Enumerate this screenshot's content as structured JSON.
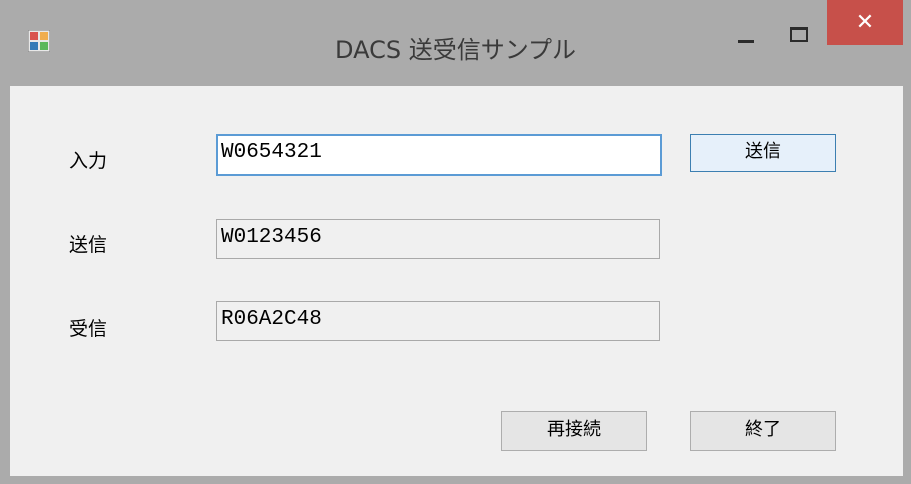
{
  "window": {
    "title": "DACS 送受信サンプル",
    "close_glyph": "✕"
  },
  "form": {
    "input": {
      "label": "入力",
      "value": "W0654321"
    },
    "send": {
      "label": "送信",
      "value": "W0123456"
    },
    "receive": {
      "label": "受信",
      "value": "R06A2C48"
    }
  },
  "buttons": {
    "send": "送信",
    "reconnect": "再接続",
    "exit": "終了"
  },
  "colors": {
    "titlebar": "#ababab",
    "close": "#c7504a",
    "client": "#f0f0f0",
    "focus_border": "#5b9bd5"
  }
}
